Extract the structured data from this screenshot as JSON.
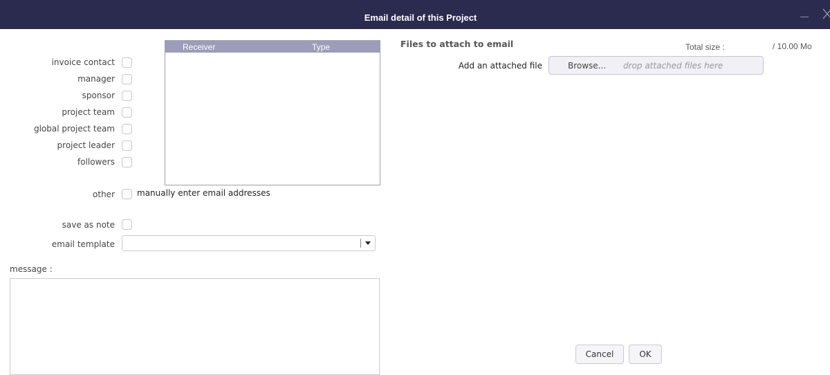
{
  "dialog": {
    "title": "Email detail of this Project",
    "minimize_icon": "minimize-icon",
    "close_icon": "close-icon"
  },
  "recipients": {
    "options": [
      {
        "label": "invoice contact",
        "checked": false
      },
      {
        "label": "manager",
        "checked": false
      },
      {
        "label": "sponsor",
        "checked": false
      },
      {
        "label": "project team",
        "checked": false
      },
      {
        "label": "global project team",
        "checked": false
      },
      {
        "label": "project leader",
        "checked": false
      },
      {
        "label": "followers",
        "checked": false
      }
    ],
    "table": {
      "columns": [
        "Receiver",
        "Type"
      ],
      "rows": []
    },
    "other": {
      "label": "other",
      "checked": false,
      "manual_label": "manually enter email addresses"
    }
  },
  "save_as_note": {
    "label": "save as note",
    "checked": false
  },
  "email_template": {
    "label": "email template",
    "value": "",
    "arrow_icon": "dropdown-arrow-icon"
  },
  "message": {
    "label": "message :",
    "value": ""
  },
  "attachments": {
    "heading": "Files to attach to email",
    "total_size_label": "Total size :",
    "size_limit": "/ 10.00 Mo",
    "add_label": "Add an attached file",
    "browse_label": "Browse...",
    "drop_hint": "drop attached files here"
  },
  "buttons": {
    "cancel": "Cancel",
    "ok": "OK"
  },
  "colors": {
    "titlebar": "#2b2a4f",
    "table_header": "#9d9cb9",
    "button_bg": "#f5f5f8"
  }
}
